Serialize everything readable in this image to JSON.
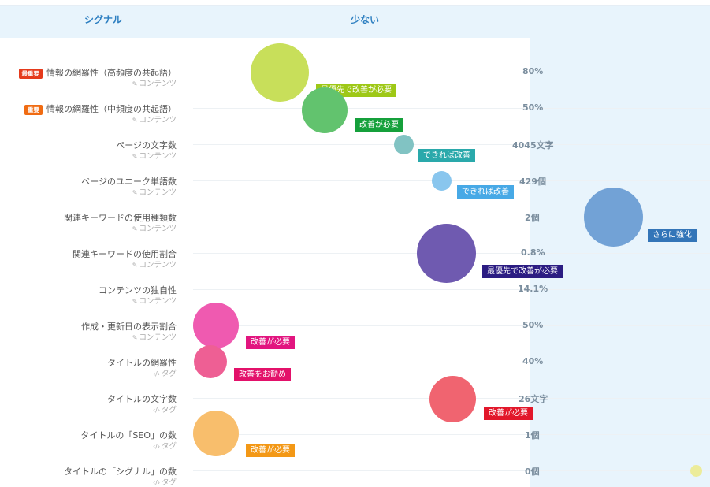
{
  "header": {
    "signal_label": "シグナル",
    "less_label": "少ない"
  },
  "rows": [
    {
      "label": "情報の網羅性（高頻度の共起語）",
      "sub": "コンテンツ",
      "sub_icon": "edit-icon",
      "badge": "最重要",
      "badge_color": "#e53a1c",
      "value": "80%",
      "bubble_color": "#c8df5a",
      "tag": "最優先で改善が必要",
      "tag_color": "#9ec816"
    },
    {
      "label": "情報の網羅性（中頻度の共起語）",
      "sub": "コンテンツ",
      "sub_icon": "edit-icon",
      "badge": "重要",
      "badge_color": "#f06b12",
      "value": "50%",
      "bubble_color": "#62c36e",
      "tag": "改善が必要",
      "tag_color": "#15a03b"
    },
    {
      "label": "ページの文字数",
      "sub": "コンテンツ",
      "sub_icon": "edit-icon",
      "badge": "",
      "value": "4045文字",
      "bubble_color": "#81c3c3",
      "tag": "できれば改善",
      "tag_color": "#2aa9ab"
    },
    {
      "label": "ページのユニーク単語数",
      "sub": "コンテンツ",
      "sub_icon": "edit-icon",
      "badge": "",
      "value": "429個",
      "bubble_color": "#89c6ee",
      "tag": "できれば改善",
      "tag_color": "#47a9e6"
    },
    {
      "label": "関連キーワードの使用種類数",
      "sub": "コンテンツ",
      "sub_icon": "edit-icon",
      "badge": "",
      "value": "2個",
      "bubble_color": "#72a2d6",
      "tag": "さらに強化",
      "tag_color": "#3375b8"
    },
    {
      "label": "関連キーワードの使用割合",
      "sub": "コンテンツ",
      "sub_icon": "edit-icon",
      "badge": "",
      "value": "0.8%",
      "bubble_color": "#6f5ab0",
      "tag": "最優先で改善が必要",
      "tag_color": "#2b1c82"
    },
    {
      "label": "コンテンツの独自性",
      "sub": "コンテンツ",
      "sub_icon": "edit-icon",
      "badge": "",
      "value": "14.1%",
      "bubble_color": "",
      "tag": "",
      "tag_color": ""
    },
    {
      "label": "作成・更新日の表示割合",
      "sub": "コンテンツ",
      "sub_icon": "edit-icon",
      "badge": "",
      "value": "50%",
      "bubble_color": "#ef5ab0",
      "tag": "改善が必要",
      "tag_color": "#e2157f"
    },
    {
      "label": "タイトルの網羅性",
      "sub": "タグ",
      "sub_icon": "code-icon",
      "badge": "",
      "value": "40%",
      "bubble_color": "#ee5f94",
      "tag": "改善をお勧め",
      "tag_color": "#e3116a"
    },
    {
      "label": "タイトルの文字数",
      "sub": "タグ",
      "sub_icon": "code-icon",
      "badge": "",
      "value": "26文字",
      "bubble_color": "#f06470",
      "tag": "改善が必要",
      "tag_color": "#e2172a"
    },
    {
      "label": "タイトルの「SEO」の数",
      "sub": "タグ",
      "sub_icon": "code-icon",
      "badge": "",
      "value": "1個",
      "bubble_color": "#f8be6c",
      "tag": "改善が必要",
      "tag_color": "#f39816"
    },
    {
      "label": "タイトルの「シグナル」の数",
      "sub": "タグ",
      "sub_icon": "code-icon",
      "badge": "",
      "value": "0個",
      "bubble_color": "#ecec9a",
      "tag": "",
      "tag_color": ""
    }
  ]
}
